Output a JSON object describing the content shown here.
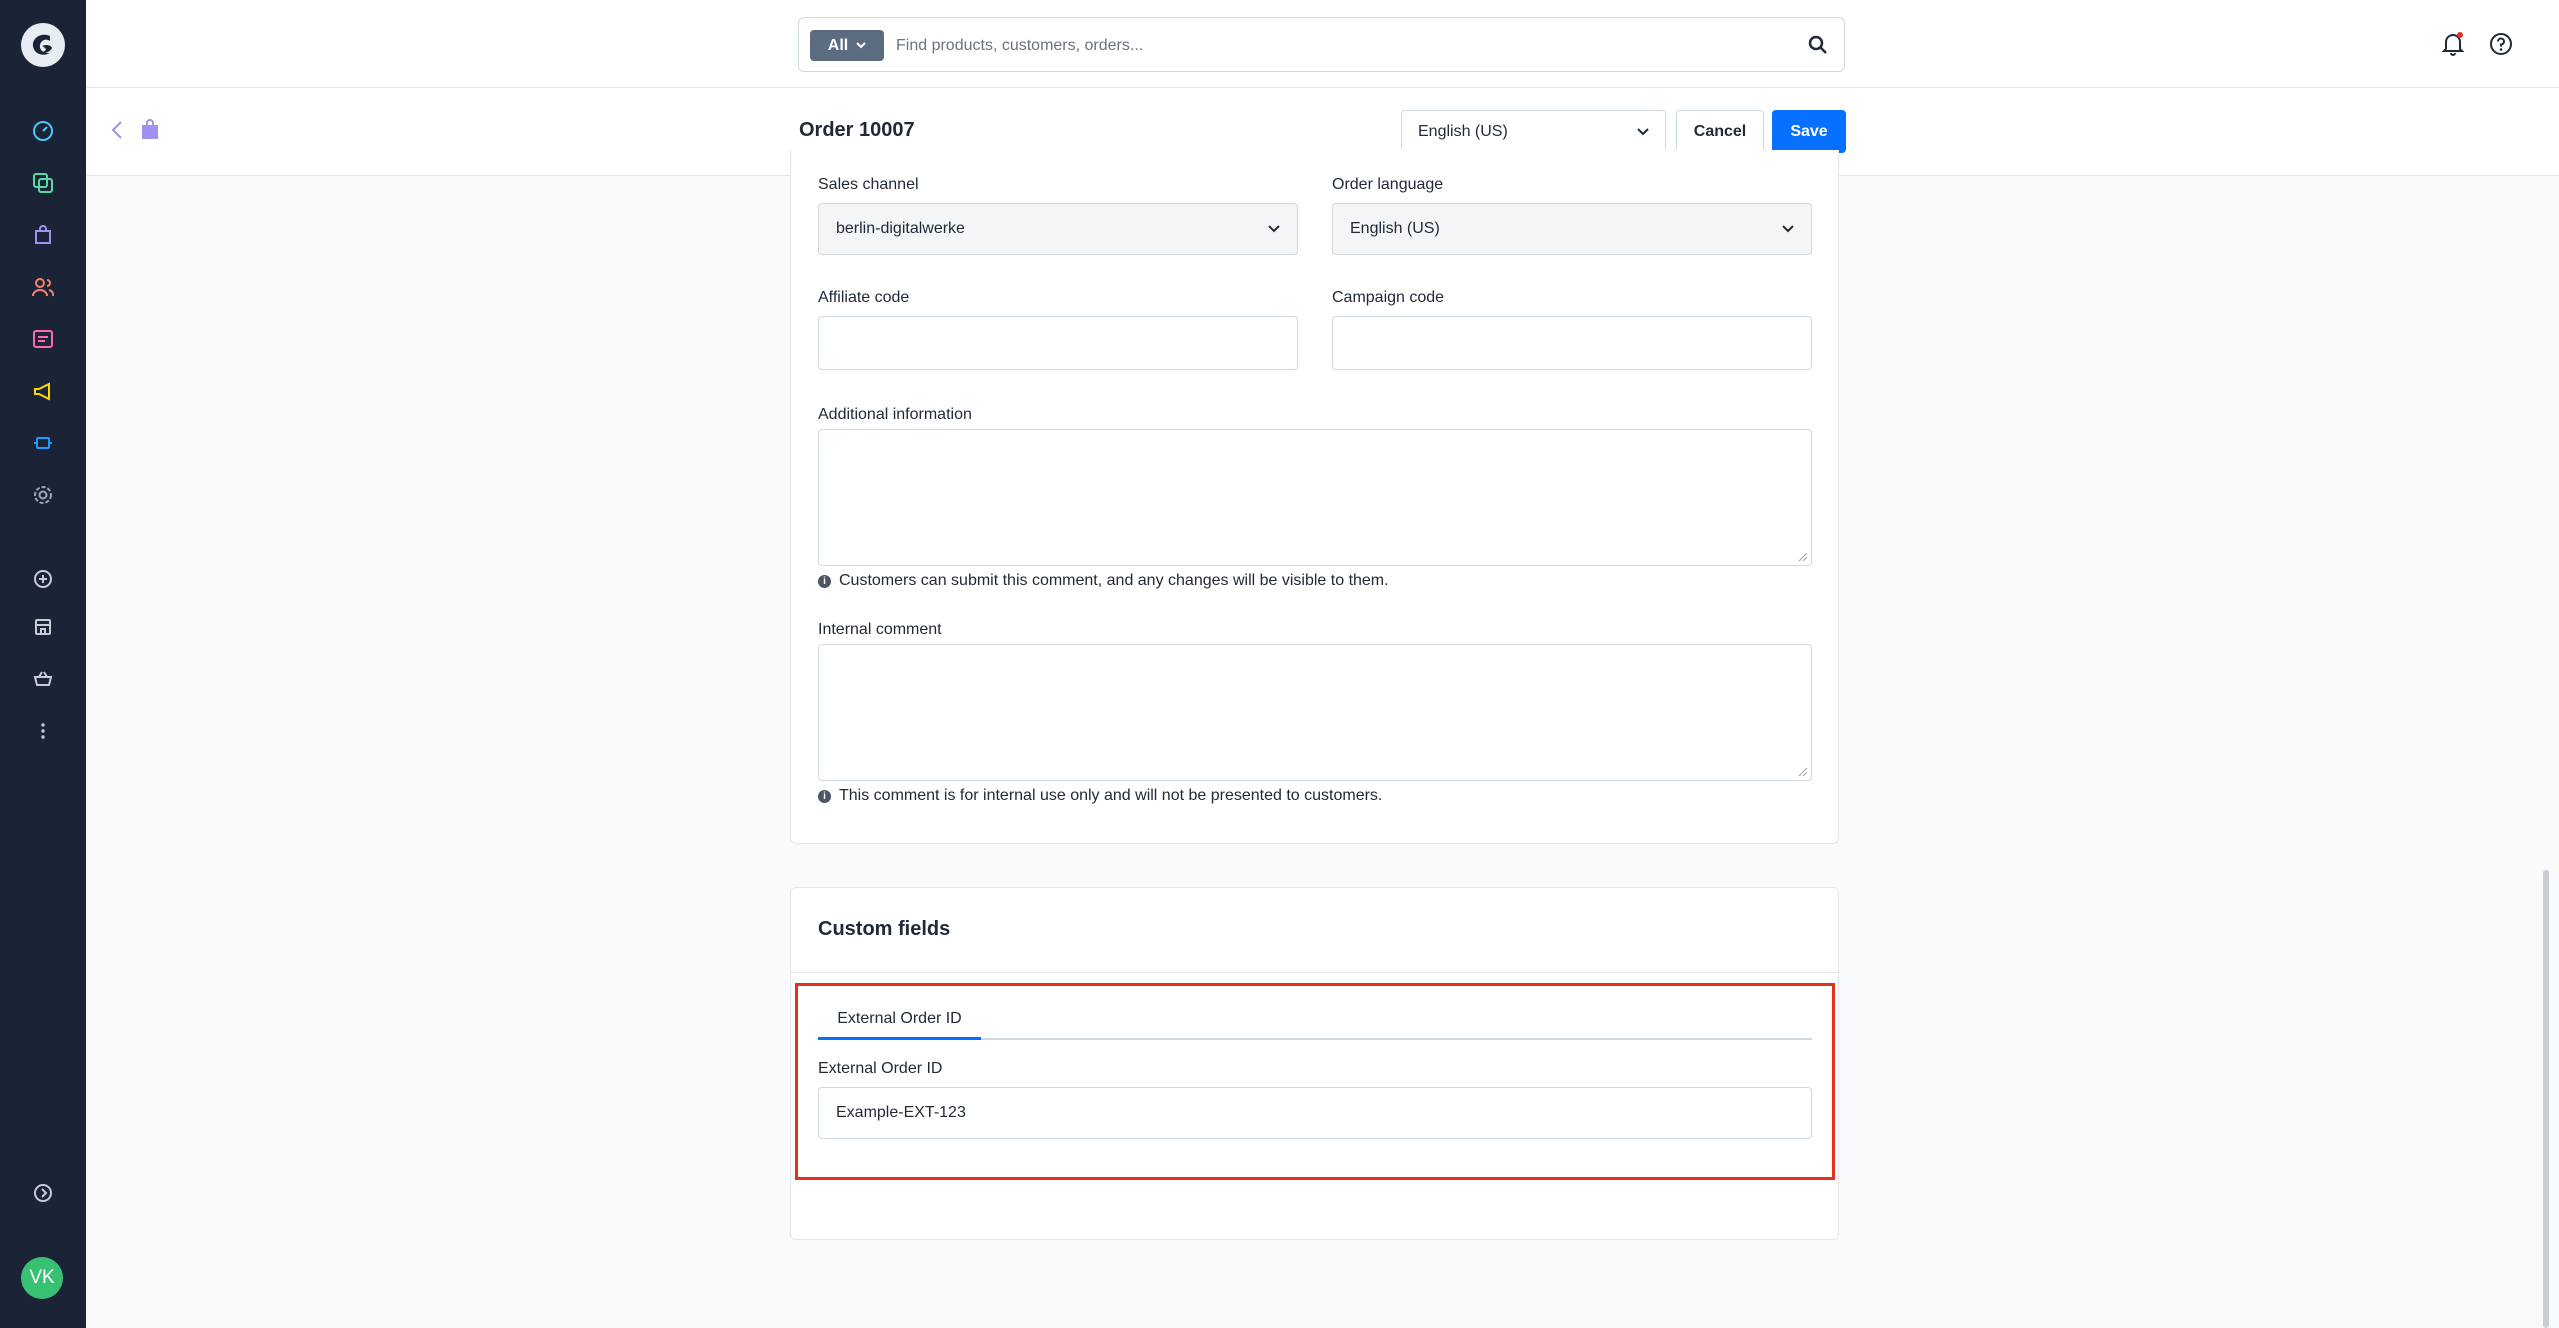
{
  "search": {
    "filter_label": "All",
    "placeholder": "Find products, customers, orders..."
  },
  "header": {
    "title": "Order 10007",
    "language": "English (US)",
    "cancel_label": "Cancel",
    "save_label": "Save"
  },
  "form": {
    "sales_channel_label": "Sales channel",
    "sales_channel_value": "berlin-digitalwerke",
    "order_language_label": "Order language",
    "order_language_value": "English (US)",
    "affiliate_code_label": "Affiliate code",
    "affiliate_code_value": "",
    "campaign_code_label": "Campaign code",
    "campaign_code_value": "",
    "additional_info_label": "Additional information",
    "additional_info_hint": "Customers can submit this comment, and any changes will be visible to them.",
    "internal_comment_label": "Internal comment",
    "internal_comment_hint": "This comment is for internal use only and will not be presented to customers."
  },
  "custom_fields": {
    "title": "Custom fields",
    "tab_label": "External Order ID",
    "field_label": "External Order ID",
    "field_value": "Example-EXT-123"
  },
  "user": {
    "initials": "VK"
  },
  "colors": {
    "sidebar": "#1b2437",
    "primary": "#0870ff",
    "highlight": "#e5331b"
  }
}
